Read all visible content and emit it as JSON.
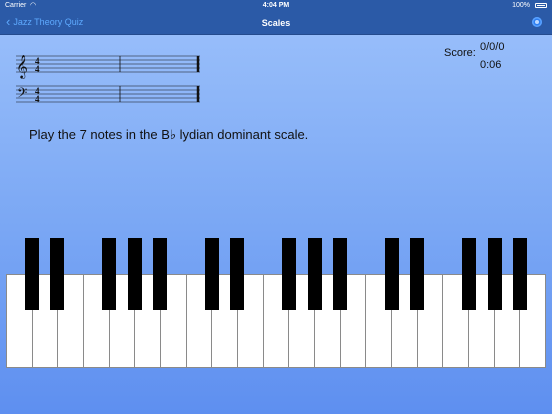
{
  "status_bar": {
    "carrier": "Carrier",
    "time": "4:04 PM",
    "battery": "100%"
  },
  "nav": {
    "back_label": "Jazz Theory Quiz",
    "title": "Scales",
    "settings_icon": "gear-icon"
  },
  "score": {
    "label": "Score:",
    "value": "0/0/0",
    "timer": "0:06"
  },
  "staff": {
    "treble_clef": "𝄞",
    "bass_clef": "𝄢",
    "time_signature": [
      "4",
      "4"
    ]
  },
  "prompt": "Play the 7 notes in the B♭ lydian dominant scale.",
  "keyboard": {
    "white_key_count": 21,
    "black_keys": [
      "C#",
      "D#",
      "F#",
      "G#",
      "A#",
      "C#",
      "D#",
      "F#",
      "G#",
      "A#",
      "C#",
      "D#",
      "F#",
      "G#",
      "A#"
    ]
  },
  "colors": {
    "bar": "#2b5aa7",
    "accent": "#5eaaff",
    "background_top": "#9cc1fb",
    "background_bottom": "#5e8ff0"
  }
}
